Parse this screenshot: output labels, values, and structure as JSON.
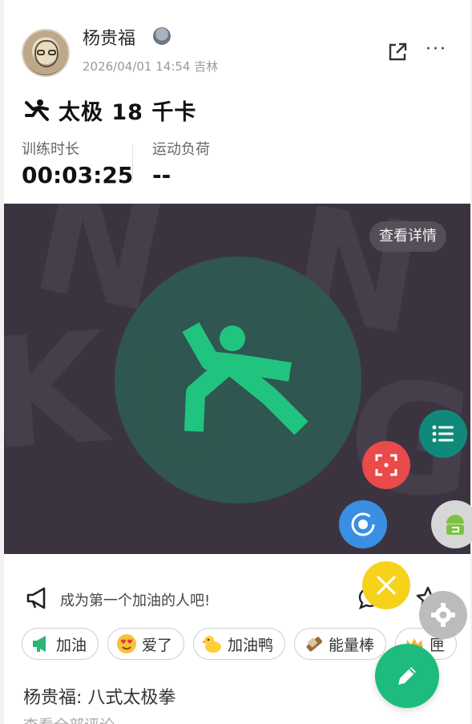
{
  "header": {
    "username": "杨贵福",
    "meta": "2026/04/01 14:54 吉林",
    "more_label": "···"
  },
  "activity": {
    "title": "太极 18 千卡",
    "icon": "taichi-figure-icon"
  },
  "stats": [
    {
      "label": "训练时长",
      "value": "00:03:25"
    },
    {
      "label": "运动负荷",
      "value": "--"
    }
  ],
  "media": {
    "detail_button": "查看详情",
    "background_letters": [
      "N",
      "K",
      "U",
      "N",
      "G"
    ]
  },
  "cheer": {
    "prompt": "成为第一个加油的人吧!"
  },
  "reactions": [
    {
      "label": "加油",
      "icon": "megaphone-icon"
    },
    {
      "label": "爱了",
      "icon": "heart-eyes-emoji-icon"
    },
    {
      "label": "加油鸭",
      "icon": "duck-icon"
    },
    {
      "label": "能量棒",
      "icon": "energy-bar-icon"
    },
    {
      "label": "匣",
      "icon": "crown-icon"
    }
  ],
  "post": {
    "text": "杨贵福: 八式太极拳",
    "view_comments": "查看全部评论"
  },
  "colors": {
    "accent_green": "#1dbb7d",
    "media_bg": "#3b3440",
    "fab_red": "#e94a4a",
    "fab_blue": "#3a8fe3",
    "fab_yellow": "#f7d21b",
    "fab_teal": "#11897a"
  }
}
